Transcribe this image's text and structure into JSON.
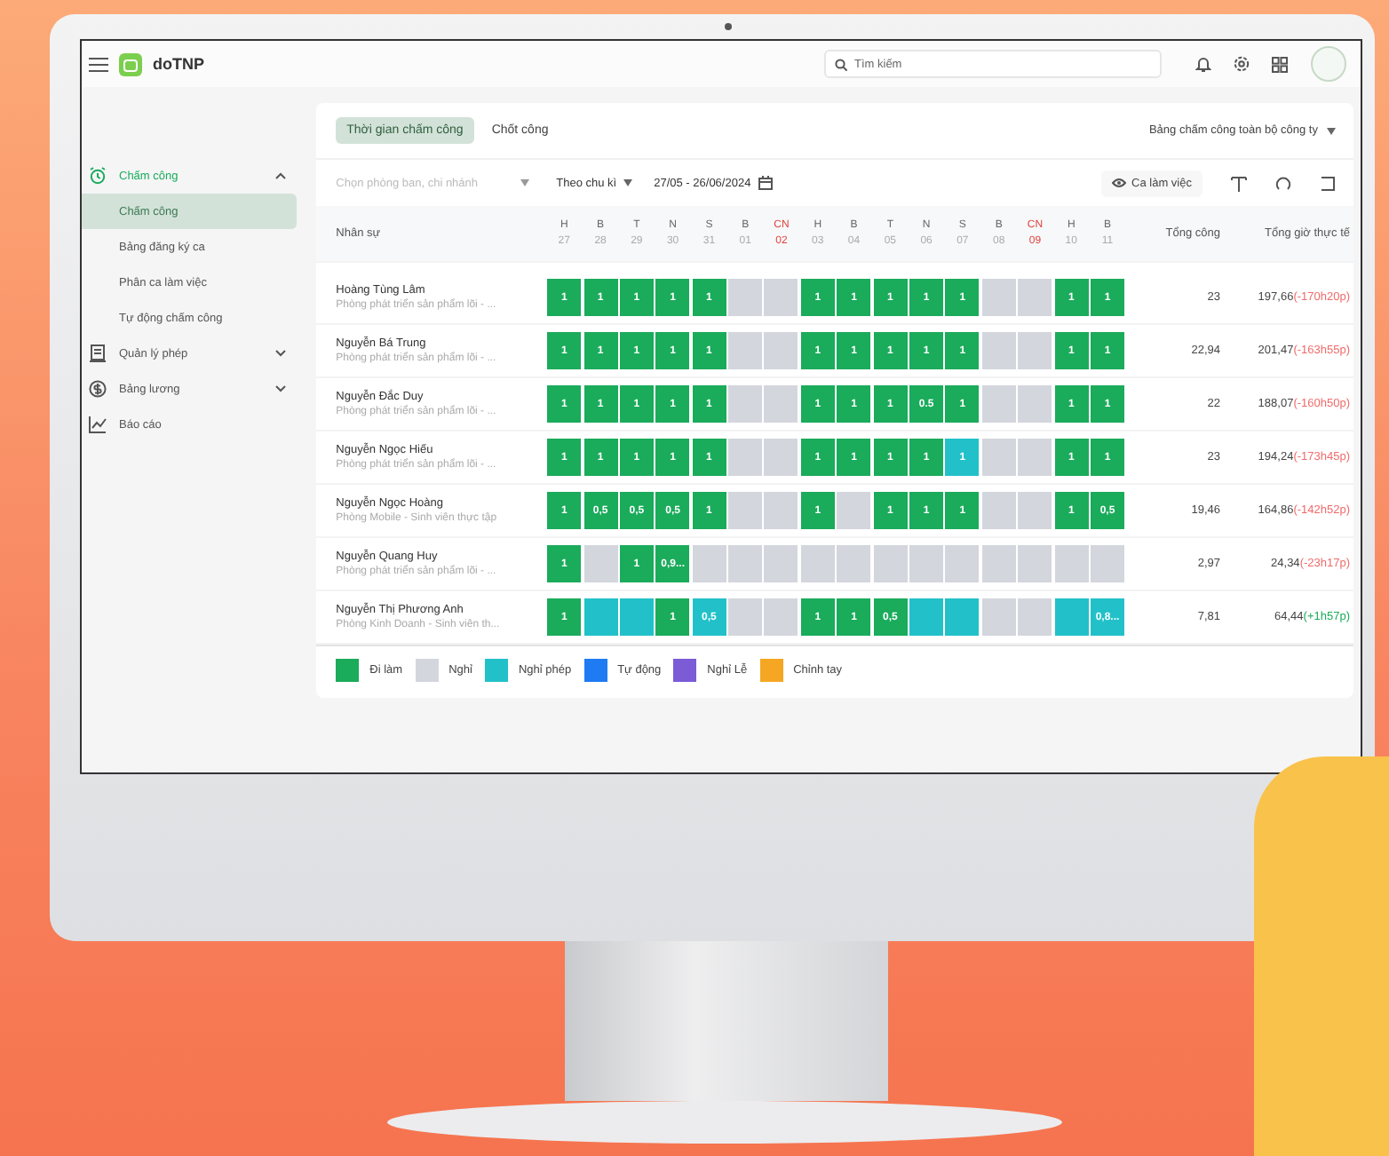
{
  "app": {
    "name": "doTNP",
    "search_placeholder": "Tìm kiếm"
  },
  "sidebar": {
    "items": [
      {
        "label": "Chấm công",
        "active": true,
        "expanded": true,
        "children": [
          {
            "label": "Chấm công",
            "selected": true
          },
          {
            "label": "Bảng đăng ký ca",
            "selected": false
          },
          {
            "label": "Phân ca làm việc",
            "selected": false
          },
          {
            "label": "Tự động chấm công",
            "selected": false
          }
        ]
      },
      {
        "label": "Quản lý phép",
        "active": false,
        "expanded": false
      },
      {
        "label": "Bảng lương",
        "active": false,
        "expanded": false
      },
      {
        "label": "Báo cáo",
        "active": false
      }
    ]
  },
  "tabs": [
    {
      "label": "Thời gian chấm công",
      "selected": true
    },
    {
      "label": "Chốt công",
      "selected": false
    }
  ],
  "scope_dropdown": "Bảng chấm công toàn bộ công ty",
  "filters": {
    "branch_placeholder": "Chọn phòng ban, chi nhánh",
    "period": "Theo chu kì",
    "date_range": "27/05 - 26/06/2024",
    "shift_button": "Ca làm việc"
  },
  "table": {
    "name_header": "Nhân sự",
    "total_header": "Tổng công",
    "hours_header": "Tổng giờ thực tế",
    "days": [
      {
        "weekday": "H",
        "date": "27",
        "sunday": false
      },
      {
        "weekday": "B",
        "date": "28",
        "sunday": false
      },
      {
        "weekday": "T",
        "date": "29",
        "sunday": false
      },
      {
        "weekday": "N",
        "date": "30",
        "sunday": false
      },
      {
        "weekday": "S",
        "date": "31",
        "sunday": false
      },
      {
        "weekday": "B",
        "date": "01",
        "sunday": false
      },
      {
        "weekday": "CN",
        "date": "02",
        "sunday": true
      },
      {
        "weekday": "H",
        "date": "03",
        "sunday": false
      },
      {
        "weekday": "B",
        "date": "04",
        "sunday": false
      },
      {
        "weekday": "T",
        "date": "05",
        "sunday": false
      },
      {
        "weekday": "N",
        "date": "06",
        "sunday": false
      },
      {
        "weekday": "S",
        "date": "07",
        "sunday": false
      },
      {
        "weekday": "B",
        "date": "08",
        "sunday": false
      },
      {
        "weekday": "CN",
        "date": "09",
        "sunday": true
      },
      {
        "weekday": "H",
        "date": "10",
        "sunday": false
      },
      {
        "weekday": "B",
        "date": "11",
        "sunday": false
      }
    ],
    "rows": [
      {
        "name": "Hoàng Tùng Lâm",
        "department": "Phòng phát triển sản phẩm lõi - ...",
        "cells": [
          {
            "kind": "work",
            "text": "1"
          },
          {
            "kind": "work",
            "text": "1"
          },
          {
            "kind": "work",
            "text": "1"
          },
          {
            "kind": "work",
            "text": "1"
          },
          {
            "kind": "work",
            "text": "1"
          },
          {
            "kind": "off"
          },
          {
            "kind": "off"
          },
          {
            "kind": "work",
            "text": "1"
          },
          {
            "kind": "work",
            "text": "1"
          },
          {
            "kind": "work",
            "text": "1"
          },
          {
            "kind": "work",
            "text": "1"
          },
          {
            "kind": "work",
            "text": "1"
          },
          {
            "kind": "off"
          },
          {
            "kind": "off"
          },
          {
            "kind": "work",
            "text": "1"
          },
          {
            "kind": "work",
            "text": "1"
          }
        ],
        "total": "23",
        "hours": "197,66",
        "diff": "(-170h20p)",
        "positive": false
      },
      {
        "name": "Nguyễn Bá Trung",
        "department": "Phòng phát triển sản phẩm lõi - ...",
        "cells": [
          {
            "kind": "work",
            "text": "1"
          },
          {
            "kind": "work",
            "text": "1"
          },
          {
            "kind": "work",
            "text": "1"
          },
          {
            "kind": "work",
            "text": "1"
          },
          {
            "kind": "work",
            "text": "1"
          },
          {
            "kind": "off"
          },
          {
            "kind": "off"
          },
          {
            "kind": "work",
            "text": "1"
          },
          {
            "kind": "work",
            "text": "1"
          },
          {
            "kind": "work",
            "text": "1"
          },
          {
            "kind": "work",
            "text": "1"
          },
          {
            "kind": "work",
            "text": "1"
          },
          {
            "kind": "off"
          },
          {
            "kind": "off"
          },
          {
            "kind": "work",
            "text": "1"
          },
          {
            "kind": "work",
            "text": "1"
          }
        ],
        "total": "22,94",
        "hours": "201,47",
        "diff": "(-163h55p)",
        "positive": false
      },
      {
        "name": "Nguyễn Đắc Duy",
        "department": "Phòng phát triển sản phẩm lõi - ...",
        "cells": [
          {
            "kind": "work",
            "text": "1"
          },
          {
            "kind": "work",
            "text": "1"
          },
          {
            "kind": "work",
            "text": "1"
          },
          {
            "kind": "work",
            "text": "1"
          },
          {
            "kind": "work",
            "text": "1"
          },
          {
            "kind": "off"
          },
          {
            "kind": "off"
          },
          {
            "kind": "work",
            "text": "1"
          },
          {
            "kind": "work",
            "text": "1"
          },
          {
            "kind": "work",
            "text": "1"
          },
          {
            "kind": "work",
            "text": "0.5"
          },
          {
            "kind": "work",
            "text": "1"
          },
          {
            "kind": "off"
          },
          {
            "kind": "off"
          },
          {
            "kind": "work",
            "text": "1"
          },
          {
            "kind": "work",
            "text": "1"
          }
        ],
        "total": "22",
        "hours": "188,07",
        "diff": "(-160h50p)",
        "positive": false
      },
      {
        "name": "Nguyễn Ngọc Hiếu",
        "department": "Phòng phát triển sản phẩm lõi - ...",
        "cells": [
          {
            "kind": "work",
            "text": "1"
          },
          {
            "kind": "work",
            "text": "1"
          },
          {
            "kind": "work",
            "text": "1"
          },
          {
            "kind": "work",
            "text": "1"
          },
          {
            "kind": "work",
            "text": "1"
          },
          {
            "kind": "off"
          },
          {
            "kind": "off"
          },
          {
            "kind": "work",
            "text": "1"
          },
          {
            "kind": "work",
            "text": "1"
          },
          {
            "kind": "work",
            "text": "1"
          },
          {
            "kind": "work",
            "text": "1"
          },
          {
            "kind": "leave",
            "text": "1"
          },
          {
            "kind": "off"
          },
          {
            "kind": "off"
          },
          {
            "kind": "work",
            "text": "1"
          },
          {
            "kind": "work",
            "text": "1"
          }
        ],
        "total": "23",
        "hours": "194,24",
        "diff": "(-173h45p)",
        "positive": false
      },
      {
        "name": "Nguyễn Ngọc Hoàng",
        "department": "Phòng Mobile - Sinh viên thực tập",
        "cells": [
          {
            "kind": "work",
            "text": "1"
          },
          {
            "kind": "work",
            "text": "0,5"
          },
          {
            "kind": "work",
            "text": "0,5"
          },
          {
            "kind": "work",
            "text": "0,5"
          },
          {
            "kind": "work",
            "text": "1"
          },
          {
            "kind": "off"
          },
          {
            "kind": "off"
          },
          {
            "kind": "work",
            "text": "1"
          },
          {
            "kind": "off"
          },
          {
            "kind": "work",
            "text": "1"
          },
          {
            "kind": "work",
            "text": "1"
          },
          {
            "kind": "work",
            "text": "1"
          },
          {
            "kind": "off"
          },
          {
            "kind": "off"
          },
          {
            "kind": "work",
            "text": "1"
          },
          {
            "kind": "work",
            "text": "0,5"
          }
        ],
        "total": "19,46",
        "hours": "164,86",
        "diff": "(-142h52p)",
        "positive": false
      },
      {
        "name": "Nguyễn Quang Huy",
        "department": "Phòng phát triển sản phẩm lõi - ...",
        "cells": [
          {
            "kind": "work",
            "text": "1"
          },
          {
            "kind": "off"
          },
          {
            "kind": "work",
            "text": "1"
          },
          {
            "kind": "work",
            "text": "0,9..."
          },
          {
            "kind": "off"
          },
          {
            "kind": "off"
          },
          {
            "kind": "off"
          },
          {
            "kind": "off"
          },
          {
            "kind": "off"
          },
          {
            "kind": "off"
          },
          {
            "kind": "off"
          },
          {
            "kind": "off"
          },
          {
            "kind": "off"
          },
          {
            "kind": "off"
          },
          {
            "kind": "off"
          },
          {
            "kind": "off"
          }
        ],
        "total": "2,97",
        "hours": "24,34",
        "diff": "(-23h17p)",
        "positive": false
      },
      {
        "name": "Nguyễn Thị Phương Anh",
        "department": "Phòng Kinh Doanh - Sinh viên th...",
        "cells": [
          {
            "kind": "work",
            "text": "1"
          },
          {
            "kind": "leave"
          },
          {
            "kind": "leave"
          },
          {
            "kind": "work",
            "text": "1"
          },
          {
            "kind": "leave",
            "text": "0,5"
          },
          {
            "kind": "off"
          },
          {
            "kind": "off"
          },
          {
            "kind": "work",
            "text": "1"
          },
          {
            "kind": "work",
            "text": "1"
          },
          {
            "kind": "work",
            "text": "0,5"
          },
          {
            "kind": "leave"
          },
          {
            "kind": "leave"
          },
          {
            "kind": "off"
          },
          {
            "kind": "off"
          },
          {
            "kind": "leave"
          },
          {
            "kind": "leave",
            "text": "0,8..."
          }
        ],
        "total": "7,81",
        "hours": "64,44",
        "diff": "(+1h57p)",
        "positive": true
      }
    ]
  },
  "legend": [
    {
      "label": "Đi làm",
      "color": "#1aab5b"
    },
    {
      "label": "Nghỉ",
      "color": "#d3d6dc"
    },
    {
      "label": "Nghỉ phép",
      "color": "#22c1c9"
    },
    {
      "label": "Tự động",
      "color": "#1e7bf2"
    },
    {
      "label": "Nghỉ Lễ",
      "color": "#7b5bd6"
    },
    {
      "label": "Chỉnh tay",
      "color": "#f5a623"
    }
  ]
}
